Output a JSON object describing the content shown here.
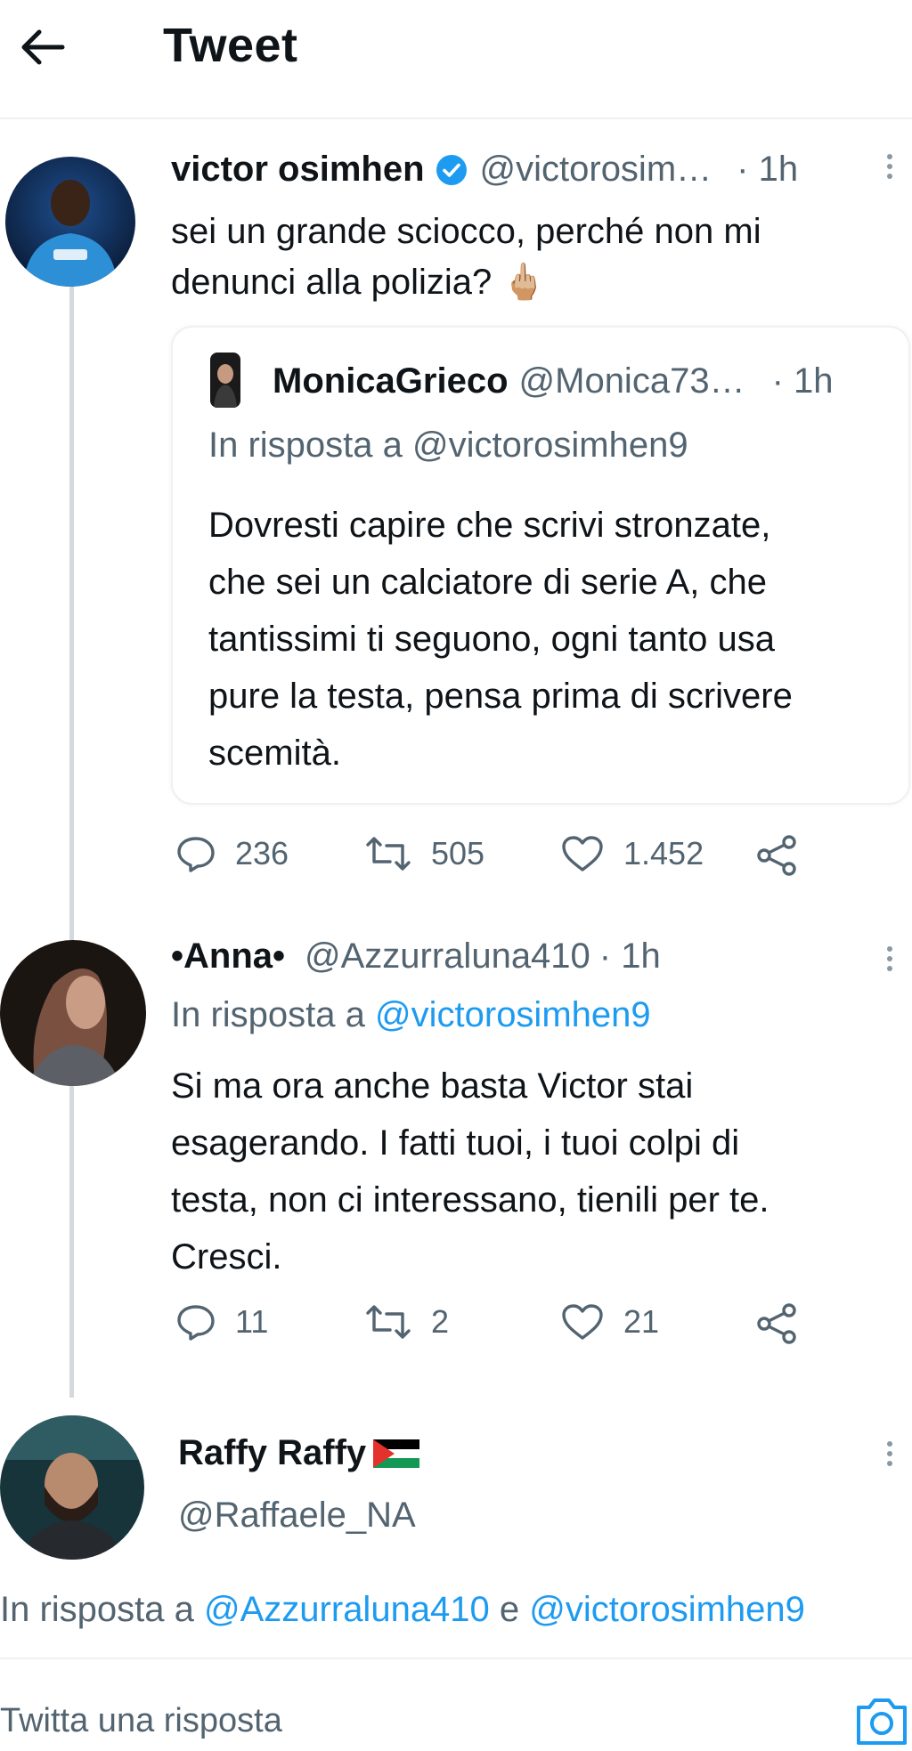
{
  "header": {
    "title": "Tweet"
  },
  "tweet": {
    "name": "victor osimhen",
    "handle": "@victorosim…",
    "time": "· 1h",
    "text_line1": "sei un grande sciocco, perché non mi",
    "text_line2": "denunci alla polizia? 🖕🏼",
    "quote": {
      "name": "MonicaGrieco",
      "handle": "@Monica73…",
      "time": "· 1h",
      "reply_to": "In risposta a @victorosimhen9",
      "lines": [
        "Dovresti capire che scrivi stronzate,",
        "che sei un calciatore di serie A, che",
        "tantissimi ti seguono, ogni tanto usa",
        "pure la testa, pensa prima di scrivere",
        "scemità."
      ]
    },
    "stats": {
      "replies": "236",
      "retweets": "505",
      "likes": "1.452"
    }
  },
  "reply1": {
    "name": "•Anna•",
    "handle": "@Azzurraluna410",
    "time": "· 1h",
    "reply_prefix": "In risposta a ",
    "reply_handle": "@victorosimhen9",
    "lines": [
      "Si ma ora anche basta Victor stai",
      "esagerando. I fatti tuoi, i tuoi colpi di",
      "testa, non ci interessano, tienili per te.",
      "Cresci."
    ],
    "stats": {
      "replies": "11",
      "retweets": "2",
      "likes": "21"
    }
  },
  "reply2": {
    "name": "Raffy Raffy",
    "handle": "@Raffaele_NA",
    "reply_prefix": "In risposta a ",
    "reply_handle1": "@Azzurraluna410",
    "reply_and": " e ",
    "reply_handle2": "@victorosimhen9"
  },
  "composer": {
    "placeholder": "Twitta una risposta"
  },
  "colors": {
    "accent": "#1d9bf0",
    "text": "#0f1419",
    "secondary": "#536471",
    "verified": "#1d9bf0"
  }
}
